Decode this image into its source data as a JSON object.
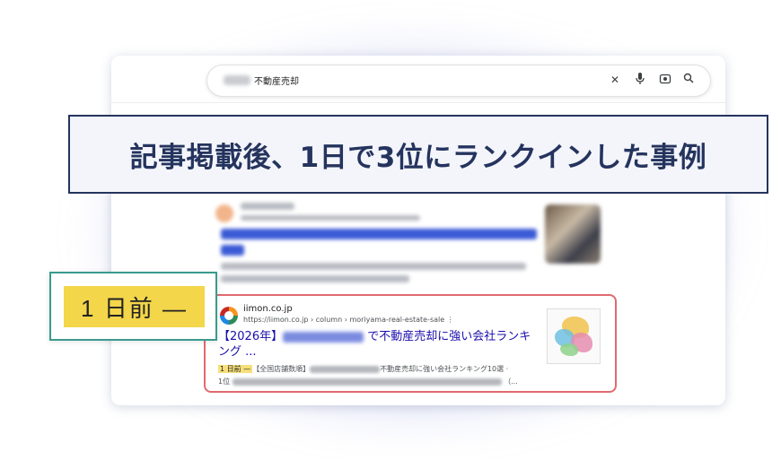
{
  "search": {
    "query": "不動産売却",
    "clear_icon": "close-icon",
    "voice_icon": "microphone-icon",
    "lens_icon": "camera-lens-icon",
    "search_icon": "search-icon"
  },
  "banner": {
    "text": "記事掲載後、1日で3位にランクインした事例"
  },
  "callout": {
    "text": "1 日前 —"
  },
  "result": {
    "site_name": "iimon.co.jp",
    "url": "https://iimon.co.jp › column › moriyama-real-estate-sale",
    "title_prefix": "【2026年】",
    "title_suffix": "で不動産売却に強い会社ランキング ...",
    "snippet_date": "1 日前 —",
    "snippet_part1": "【全国店舗数順】",
    "snippet_part2": "不動産売却に強い会社ランキング10選 ·",
    "snippet_line2_prefix": "1位",
    "snippet_line2_suffix": "（..."
  },
  "colors": {
    "banner_border": "#25345e",
    "banner_text": "#25345e",
    "result_border": "#e06a6f",
    "callout_border": "#3a9a8e",
    "highlight": "#f3d64a",
    "link": "#1a0dab"
  }
}
